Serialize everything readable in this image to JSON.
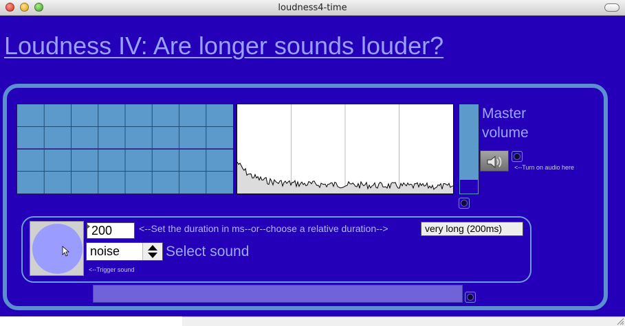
{
  "window": {
    "title": "loudness4-time"
  },
  "heading": "Loudness IV: Are longer sounds louder?",
  "master": {
    "label_line1": "Master",
    "label_line2": "volume",
    "level": 0.15
  },
  "audio": {
    "note": "<--Turn on audio here"
  },
  "duration": {
    "value": "200",
    "label": "<--Set the duration in ms--or--choose a relative duration-->",
    "menu_selected": "very long (200ms)"
  },
  "sound": {
    "menu_selected": "noise",
    "label": "Select sound"
  },
  "trigger": {
    "note": "<--Trigger sound"
  },
  "progress": {
    "value": 1.0
  },
  "colors": {
    "background": "#2400b8",
    "panel_border": "#5b8fcf",
    "scope_bg": "#5b9acb",
    "label_text": "#9aa8ff",
    "trigger_circle": "#9a9cff"
  },
  "icons": {
    "speaker": "speaker-icon",
    "cursor": "arrow-cursor-icon",
    "toggle": "toggle-dot-icon"
  }
}
